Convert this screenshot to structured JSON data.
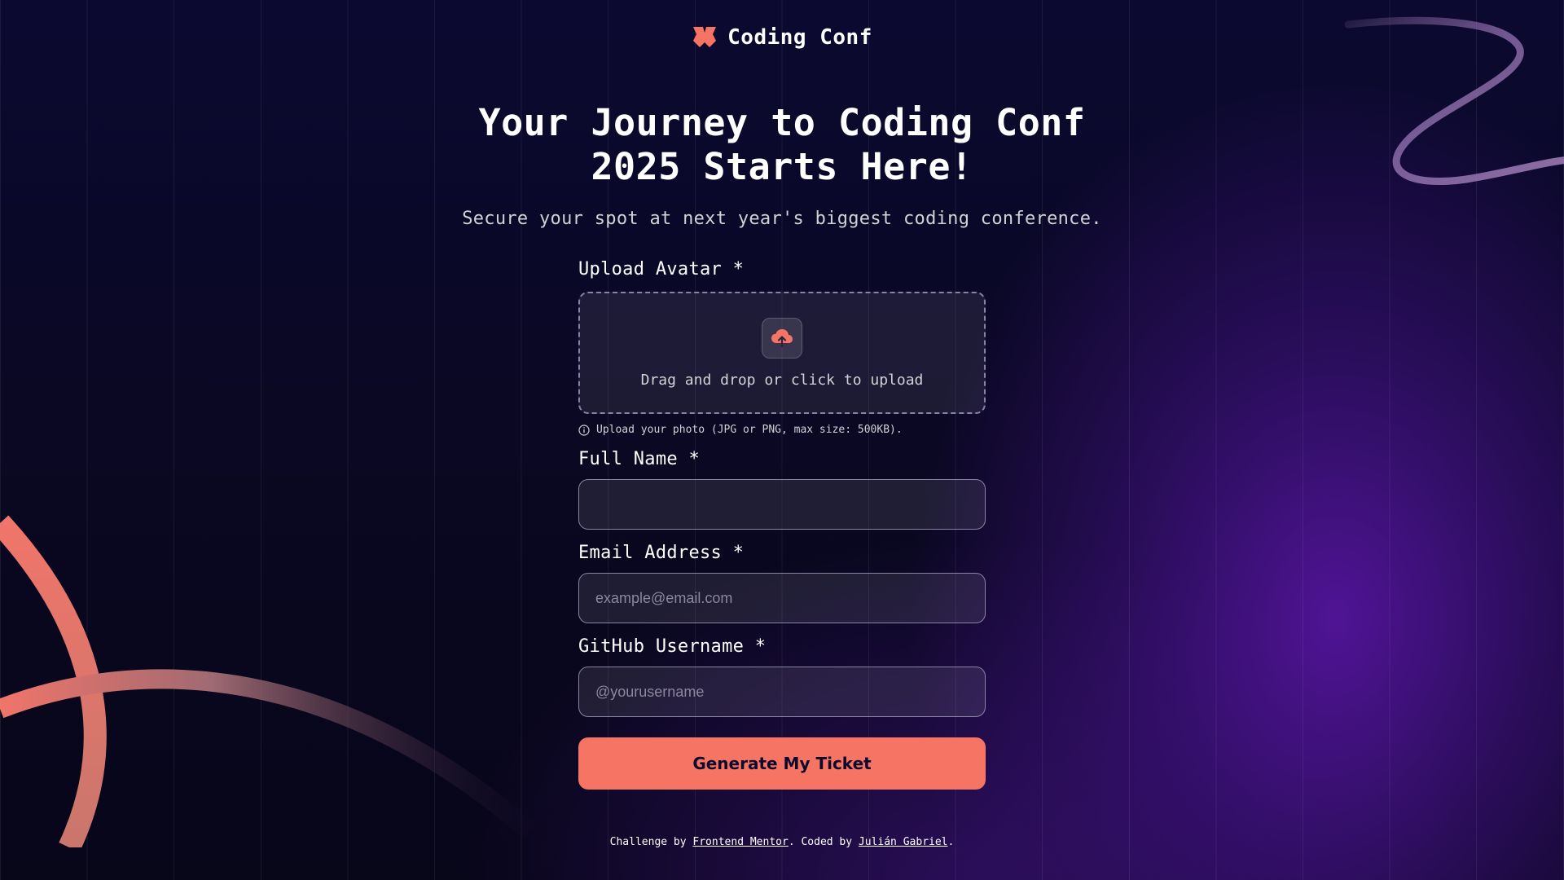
{
  "header": {
    "brand": "Coding Conf"
  },
  "hero": {
    "title": "Your Journey to Coding Conf 2025 Starts Here!",
    "subtitle": "Secure your spot at next year's biggest coding conference."
  },
  "form": {
    "avatar": {
      "label": "Upload Avatar *",
      "dropzone_text": "Drag and drop or click to upload",
      "hint": "Upload your photo (JPG or PNG, max size: 500KB)."
    },
    "full_name": {
      "label": "Full Name *",
      "value": "",
      "placeholder": ""
    },
    "email": {
      "label": "Email Address *",
      "value": "",
      "placeholder": "example@email.com"
    },
    "github": {
      "label": "GitHub Username *",
      "value": "",
      "placeholder": "@yourusername"
    },
    "submit_label": "Generate My Ticket"
  },
  "footer": {
    "prefix": "Challenge by",
    "link1": "Frontend Mentor",
    "middle": ". Coded by",
    "link2": "Julián Gabriel",
    "suffix": "."
  },
  "colors": {
    "accent": "#f57463",
    "background": "#0a0823",
    "purple_glow": "#5c16aa"
  },
  "icons": {
    "logo": "ticket-logo-icon",
    "upload": "cloud-upload-icon",
    "info": "info-icon"
  }
}
